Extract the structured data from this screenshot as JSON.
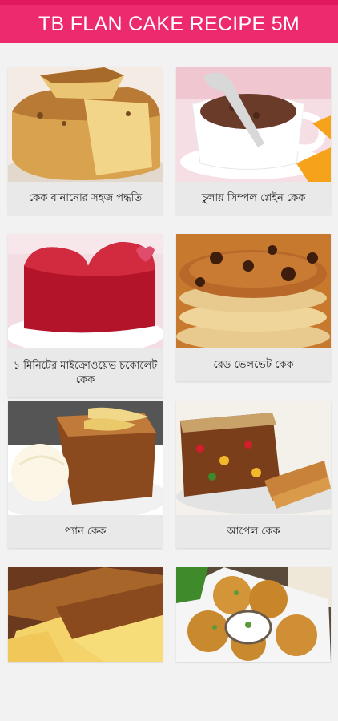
{
  "app": {
    "title": "TB FLAN CAKE RECIPE 5M"
  },
  "recipes": [
    {
      "label": "কেক বানানোর সহজ পদ্ধতি",
      "image": "sponge-cake-slice"
    },
    {
      "label": "চুলায় সিম্পল প্লেইন কেক",
      "image": "chocolate-mug-cake"
    },
    {
      "label": "১ মিনিটের মাইক্রোওয়েভ চকোলেট কেক",
      "image": "red-velvet-heart-cake"
    },
    {
      "label": "রেড ভেলভেট কেক",
      "image": "chocolate-chip-pancakes"
    },
    {
      "label": "প্যান কেক",
      "image": "banana-cake-ice-cream"
    },
    {
      "label": "আপেল কেক",
      "image": "fruit-cake-loaf"
    },
    {
      "label": "",
      "image": "pound-cake-loaf"
    },
    {
      "label": "",
      "image": "fritters-with-dip"
    }
  ]
}
